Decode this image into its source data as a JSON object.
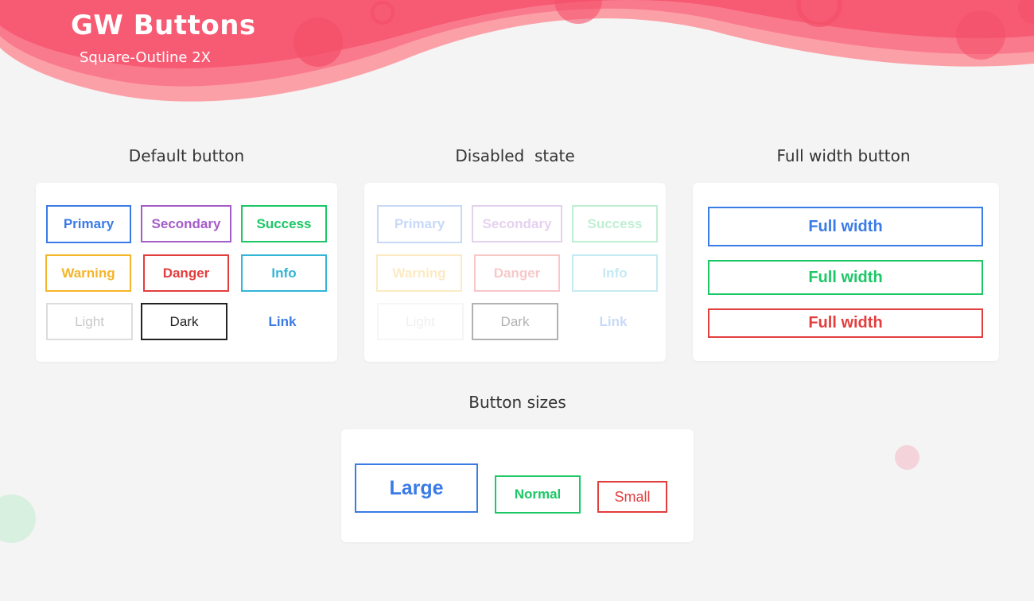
{
  "header": {
    "title": "GW Buttons",
    "subtitle": "Square-Outline 2X"
  },
  "colors": {
    "primary": "#3a7be6",
    "secondary": "#a45cc7",
    "success": "#1cc765",
    "warning": "#f5b52b",
    "danger": "#e33e3e",
    "info": "#33b5d6",
    "light": "#dddddd",
    "dark": "#222222",
    "hero": "#f85a78"
  },
  "sections": {
    "default": {
      "title": "Default button",
      "buttons": [
        "Primary",
        "Secondary",
        "Success",
        "Warning",
        "Danger",
        "Info",
        "Light",
        "Dark",
        "Link"
      ]
    },
    "disabled": {
      "title": "Disabled  state",
      "buttons": [
        "Primary",
        "Secondary",
        "Success",
        "Warning",
        "Danger",
        "Info",
        "Light",
        "Dark",
        "Link"
      ]
    },
    "full_width": {
      "title": "Full width button",
      "buttons": [
        "Full width",
        "Full width",
        "Full width"
      ]
    },
    "sizes": {
      "title": "Button sizes",
      "buttons": [
        "Large",
        "Normal",
        "Small"
      ]
    }
  }
}
